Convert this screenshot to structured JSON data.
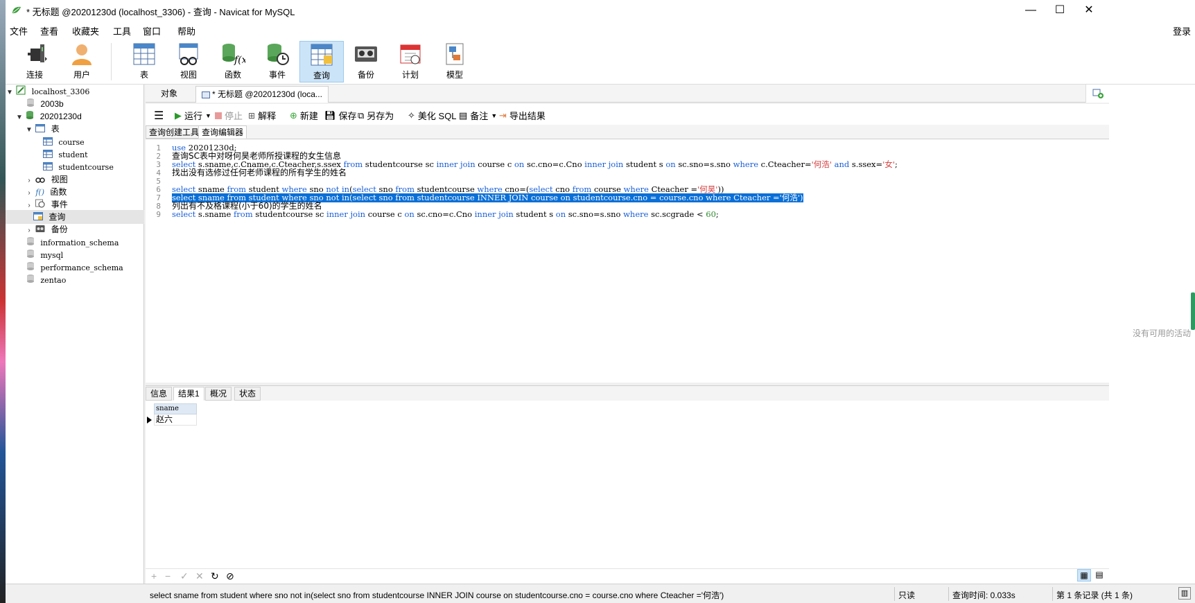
{
  "window": {
    "title": "* 无标题 @20201230d (localhost_3306) - 查询 - Navicat for MySQL",
    "controls": {
      "minimize": "—",
      "maximize": "☐",
      "close": "✕"
    }
  },
  "menu": {
    "items": [
      "文件",
      "查看",
      "收藏夹",
      "工具",
      "窗口",
      "帮助"
    ],
    "login": "登录"
  },
  "toolbar": {
    "buttons": [
      {
        "label": "连接",
        "icon": "plug-icon"
      },
      {
        "label": "用户",
        "icon": "user-icon"
      },
      {
        "label": "表",
        "icon": "table-icon"
      },
      {
        "label": "视图",
        "icon": "view-icon"
      },
      {
        "label": "函数",
        "icon": "function-icon"
      },
      {
        "label": "事件",
        "icon": "event-icon"
      },
      {
        "label": "查询",
        "icon": "query-icon"
      },
      {
        "label": "备份",
        "icon": "backup-icon"
      },
      {
        "label": "计划",
        "icon": "schedule-icon"
      },
      {
        "label": "模型",
        "icon": "model-icon"
      }
    ],
    "active": "查询"
  },
  "tree": {
    "connection": "localhost_3306",
    "db_2003b": "2003b",
    "db_current": "20201230d",
    "tables_label": "表",
    "tables": [
      "course",
      "student",
      "studentcourse"
    ],
    "views": "视图",
    "functions": "函数",
    "events": "事件",
    "queries": "查询",
    "backups": "备份",
    "other_dbs": [
      "information_schema",
      "mysql",
      "performance_schema",
      "zentao"
    ]
  },
  "tabs": {
    "objects": "对象",
    "query_tab": "* 无标题 @20201230d (loca..."
  },
  "query_toolbar": {
    "run": "运行",
    "stop": "停止",
    "explain": "解释",
    "new": "新建",
    "save": "保存",
    "save_as": "另存为",
    "beautify": "美化 SQL",
    "comment": "备注",
    "export": "导出结果"
  },
  "subtabs": {
    "builder": "查询创建工具",
    "editor": "查询编辑器"
  },
  "editor": {
    "line_numbers": [
      "1",
      "2",
      "3",
      "4",
      "5",
      "6",
      "7",
      "8",
      "9"
    ],
    "l1": {
      "kw": "use",
      "rest": " 20201230d;"
    },
    "l2": "查询SC表中对呀何昊老师所授课程的女生信息",
    "l3": {
      "p1": "select",
      "p2": " s.sname,c.Cname,c.Cteacher,s.ssex ",
      "p3": "from",
      "p4": " studentcourse sc ",
      "p5": "inner join",
      "p6": " course c ",
      "p7": "on",
      "p8": " sc.cno=c.Cno ",
      "p9": "inner join",
      "p10": " student s ",
      "p11": "on",
      "p12": " sc.sno=s.sno ",
      "p13": "where",
      "p14": " c.Cteacher=",
      "p15": "'何浩'",
      "p16": " ",
      "p17": "and",
      "p18": " s.ssex=",
      "p19": "'女'",
      "p20": ";"
    },
    "l4": "找出没有选修过任何老师课程的所有学生的姓名",
    "l6": {
      "p1": "select",
      "p2": " sname ",
      "p3": "from",
      "p4": " student ",
      "p5": "where",
      "p6": " sno ",
      "p7": "not in",
      "p8": "(",
      "p9": "select",
      "p10": " sno ",
      "p11": "from",
      "p12": " studentcourse ",
      "p13": "where",
      "p14": " cno=(",
      "p15": "select",
      "p16": " cno ",
      "p17": "from",
      "p18": " course ",
      "p19": "where",
      "p20": " Cteacher =",
      "p21": "'何昊'",
      "p22": "))"
    },
    "l7": "select sname from student where sno not in(select sno from studentcourse INNER JOIN course on studentcourse.cno = course.cno where Cteacher ='何浩')",
    "l8": "列出有不及格课程(小于60)的学生的姓名",
    "l9": {
      "p1": "select",
      "p2": " s.sname ",
      "p3": "from",
      "p4": " studentcourse sc ",
      "p5": "inner join",
      "p6": " course c ",
      "p7": "on",
      "p8": " sc.cno=c.Cno ",
      "p9": "inner join",
      "p10": " student s ",
      "p11": "on",
      "p12": " sc.sno=s.sno ",
      "p13": "where",
      "p14": " sc.scgrade < ",
      "p15": "60",
      "p16": ";"
    }
  },
  "result_tabs": [
    "信息",
    "结果1",
    "概况",
    "状态"
  ],
  "grid": {
    "columns": [
      "sname"
    ],
    "rows": [
      [
        "赵六"
      ]
    ]
  },
  "grid_tools": [
    "+",
    "−",
    "✓",
    "✕",
    "↻",
    "⊘"
  ],
  "status": {
    "sql": "select sname from student where sno not in(select sno from studentcourse INNER JOIN course on studentcourse.cno = course.cno where Cteacher ='何浩')",
    "readonly": "只读",
    "query_time": "查询时间: 0.033s",
    "records": "第 1 条记录 (共 1 条)"
  },
  "side": {
    "no_activity": "没有可用的活动"
  }
}
